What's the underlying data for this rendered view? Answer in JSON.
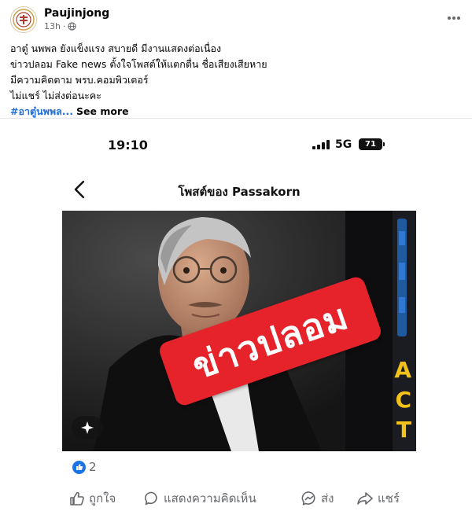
{
  "post": {
    "author": "Paujinjong",
    "time": "13h",
    "caption_lines": [
      "อาตู๋ นพพล ยังแข็งแรง สบายดี มีงานแสดงต่อเนื่อง",
      "ข่าวปลอม Fake news ตั้งใจโพสต์ให้แตกตื่น ชื่อเสียงเสียหาย",
      "มีความคิดตาม พรบ.คอมพิวเตอร์",
      "ไม่แชร์ ไม่ส่งต่อนะคะ"
    ],
    "hashtag": "#อาตู๋นพพล...",
    "see_more": "See more"
  },
  "screenshot": {
    "status_time": "19:10",
    "network": "5G",
    "battery": "71",
    "title": "โพสต์ของ Passakorn",
    "banner_text": "ข่าวปลอม",
    "side_letters": [
      "A",
      "C",
      "T"
    ]
  },
  "reactions": {
    "count": "2"
  },
  "actions": {
    "like": "ถูกใจ",
    "comment": "แสดงความคิดเห็น",
    "send": "ส่ง",
    "share": "แชร์"
  },
  "colors": {
    "link_blue": "#216fdb",
    "like_blue": "#1b74e4",
    "banner_red": "#e6232a",
    "muted": "#65676b"
  },
  "icons": [
    "avatar-logo-icon",
    "globe-icon",
    "more-options-icon",
    "back-chevron-icon",
    "like-icon",
    "comment-icon",
    "messenger-icon",
    "share-icon",
    "ai-sparkle-icon"
  ]
}
